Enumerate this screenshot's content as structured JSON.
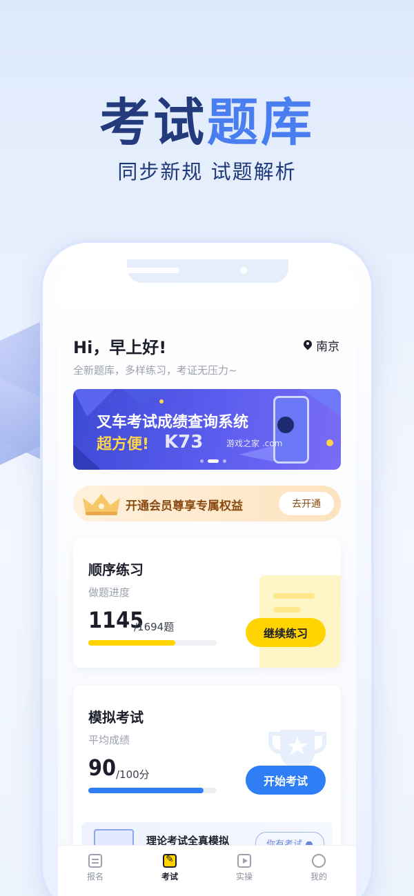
{
  "hero": {
    "title_part1": "考试",
    "title_part2": "题库",
    "subtitle": "同步新规 试题解析"
  },
  "header": {
    "greeting": "Hi，早上好!",
    "location": "南京",
    "tagline": "全新题库，多样练习，考证无压力~"
  },
  "banner": {
    "line1": "叉车考试成绩查询系统",
    "line2": "超方便!",
    "watermark_logo": "K73",
    "watermark_site": "游戏之家 .com",
    "dots": 3,
    "active_dot": 1
  },
  "vip": {
    "text": "开通会员尊享专属权益",
    "button": "去开通"
  },
  "practice": {
    "title": "顺序练习",
    "subtitle": "做题进度",
    "value": "1145",
    "total": "/1694题",
    "progress": 0.676,
    "button": "继续练习",
    "progress_color": "#ffd400",
    "button_color": "#ffd400"
  },
  "exam": {
    "title": "模拟考试",
    "subtitle": "平均成绩",
    "value": "90",
    "total": "/100分",
    "progress": 0.9,
    "button": "开始考试",
    "progress_color": "#2f7ef5",
    "button_color": "#2f7ef5",
    "inner": {
      "title": "理论考试全真模拟",
      "button": "你有考试 ●"
    }
  },
  "tabbar": {
    "items": [
      {
        "label": "报名",
        "icon": "list-icon"
      },
      {
        "label": "考试",
        "icon": "pencil-icon"
      },
      {
        "label": "实操",
        "icon": "play-icon"
      },
      {
        "label": "我的",
        "icon": "user-icon"
      }
    ],
    "active": 1
  },
  "colors": {
    "brand_dark": "#233a7c",
    "brand_blue": "#4a7ef0",
    "yellow": "#ffd400",
    "blue": "#2f7ef5"
  }
}
